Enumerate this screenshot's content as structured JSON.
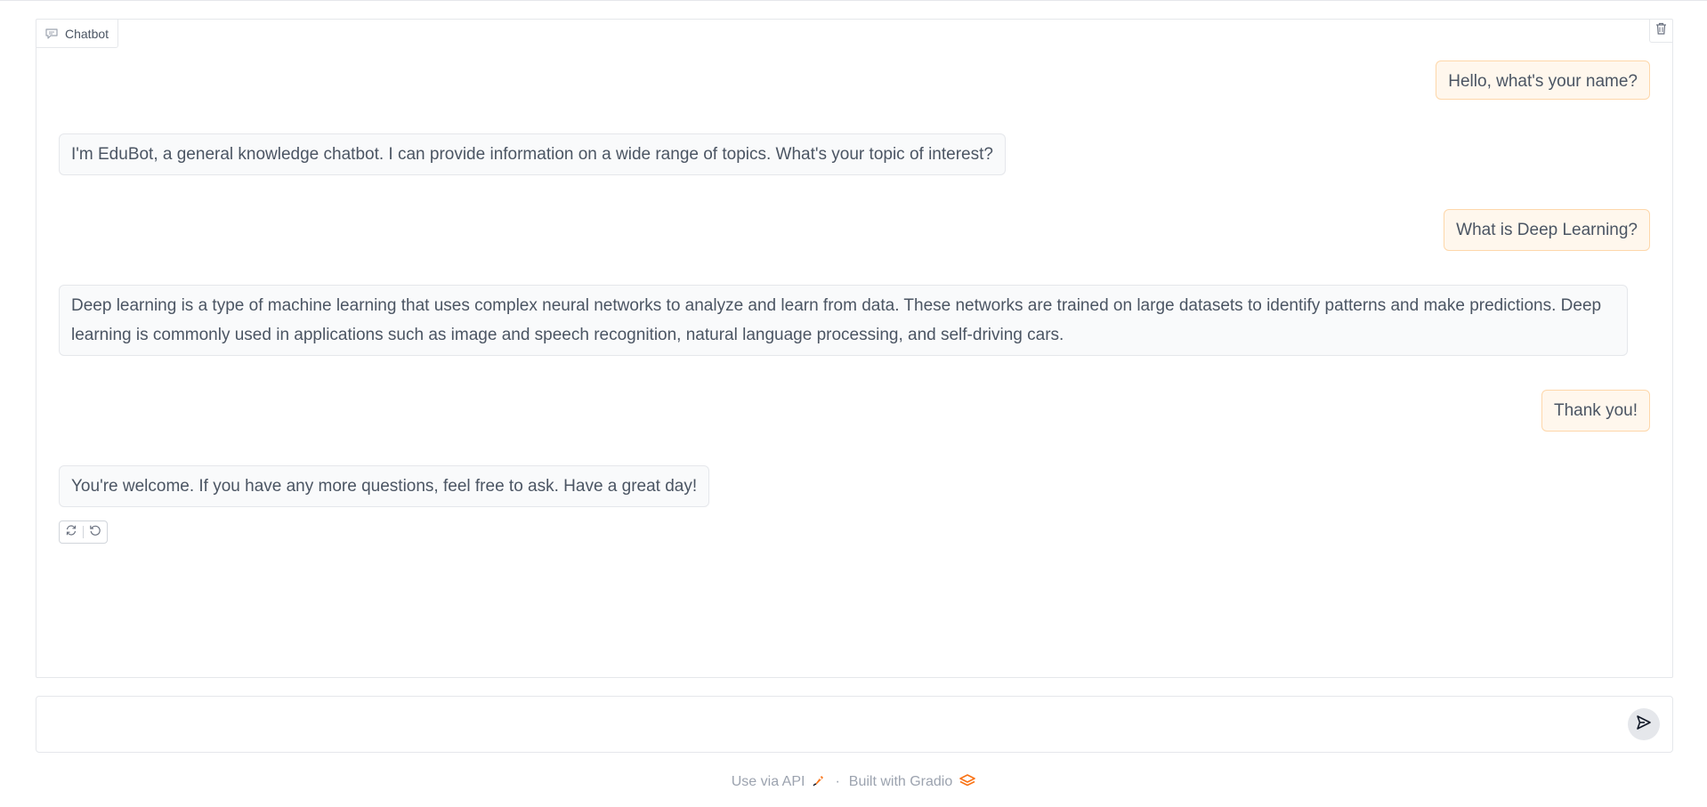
{
  "chatbot": {
    "label": "Chatbot",
    "messages": [
      {
        "role": "user",
        "text": "Hello, what's your name?"
      },
      {
        "role": "bot",
        "text": "I'm EduBot, a general knowledge chatbot. I can provide information on a wide range of topics. What's your topic of interest?"
      },
      {
        "role": "user",
        "text": "What is Deep Learning?"
      },
      {
        "role": "bot",
        "text": "Deep learning is a type of machine learning that uses complex neural networks to analyze and learn from data. These networks are trained on large datasets to identify patterns and make predictions. Deep learning is commonly used in applications such as image and speech recognition, natural language processing, and self-driving cars."
      },
      {
        "role": "user",
        "text": "Thank you!"
      },
      {
        "role": "bot",
        "text": "You're welcome. If you have any more questions, feel free to ask. Have a great day!"
      }
    ],
    "icons": {
      "label_icon": "chat-bubble-icon",
      "clear_icon": "trash-icon",
      "retry_icon": "retry-icon",
      "undo_icon": "undo-icon"
    }
  },
  "input": {
    "value": "",
    "placeholder": "",
    "send_icon": "send-icon"
  },
  "footer": {
    "api_label": "Use via API",
    "separator": "·",
    "built_label": "Built with Gradio",
    "api_icon": "rocket-icon",
    "gradio_icon": "gradio-logo-icon"
  },
  "colors": {
    "user_bubble_bg": "#fff7ed",
    "user_bubble_border": "#fed7aa",
    "bot_bubble_bg": "#f9fafb",
    "bot_bubble_border": "#e5e7eb",
    "accent": "#f97316"
  }
}
